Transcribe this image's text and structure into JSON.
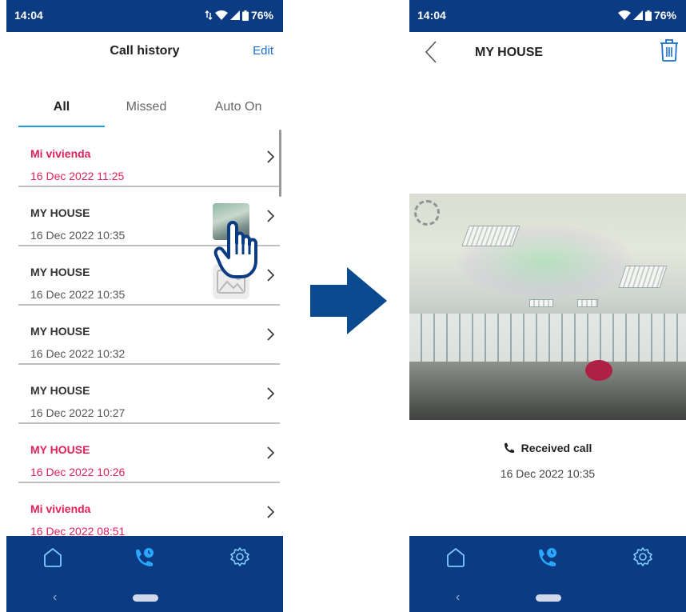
{
  "left_screen": {
    "status": {
      "time": "14:04",
      "battery": "76%"
    },
    "header": {
      "title": "Call history",
      "edit_label": "Edit"
    },
    "tabs": [
      {
        "label": "All",
        "active": true
      },
      {
        "label": "Missed",
        "active": false
      },
      {
        "label": "Auto On",
        "active": false
      }
    ],
    "calls": [
      {
        "name": "Mi vivienda",
        "date": "16 Dec 2022 11:25",
        "missed": true,
        "thumbnail": "none"
      },
      {
        "name": "MY HOUSE",
        "date": "16 Dec 2022 10:35",
        "missed": false,
        "thumbnail": "photo"
      },
      {
        "name": "MY HOUSE",
        "date": "16 Dec 2022 10:35",
        "missed": false,
        "thumbnail": "image-placeholder-icon"
      },
      {
        "name": "MY HOUSE",
        "date": "16 Dec 2022 10:32",
        "missed": false,
        "thumbnail": "none"
      },
      {
        "name": "MY HOUSE",
        "date": "16 Dec 2022 10:27",
        "missed": false,
        "thumbnail": "none"
      },
      {
        "name": "MY HOUSE",
        "date": "16 Dec 2022 10:26",
        "missed": true,
        "thumbnail": "none"
      },
      {
        "name": "Mi vivienda",
        "date": "16 Dec 2022 08:51",
        "missed": true,
        "thumbnail": "none"
      }
    ],
    "bottom_nav": [
      "home-icon",
      "call-history-icon",
      "settings-icon"
    ]
  },
  "right_screen": {
    "status": {
      "time": "14:04",
      "battery": "76%"
    },
    "header": {
      "title": "MY HOUSE"
    },
    "call_type": "Received call",
    "call_date": "16 Dec 2022 10:35",
    "bottom_nav": [
      "home-icon",
      "call-history-icon",
      "settings-icon"
    ]
  },
  "colors": {
    "brand_blue": "#0b3b82",
    "missed_red": "#e0215a",
    "accent_cyan": "#1aa0e0",
    "link_blue": "#1a6fd1"
  }
}
